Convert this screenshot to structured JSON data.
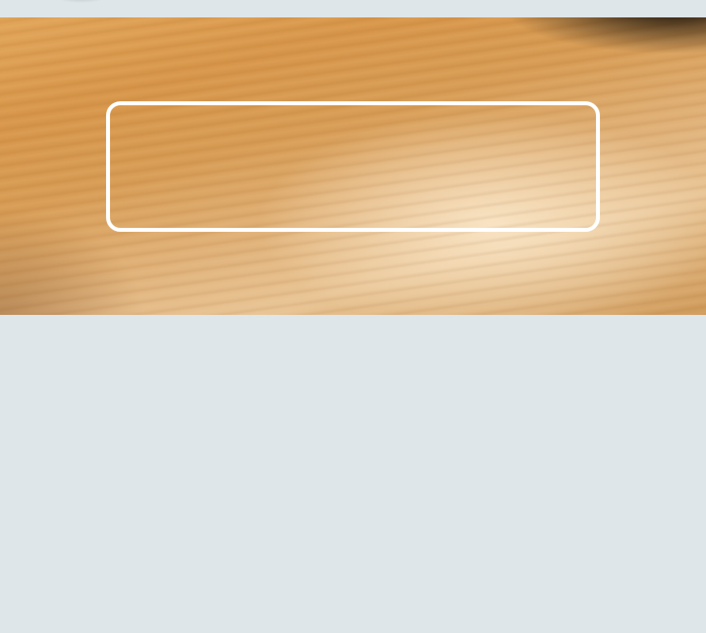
{
  "camera": {
    "scene": "wood-surface",
    "scan_frame_color": "#ffffff"
  },
  "colors": {
    "background": "#dfe6ea",
    "wood": "#d99b50"
  }
}
